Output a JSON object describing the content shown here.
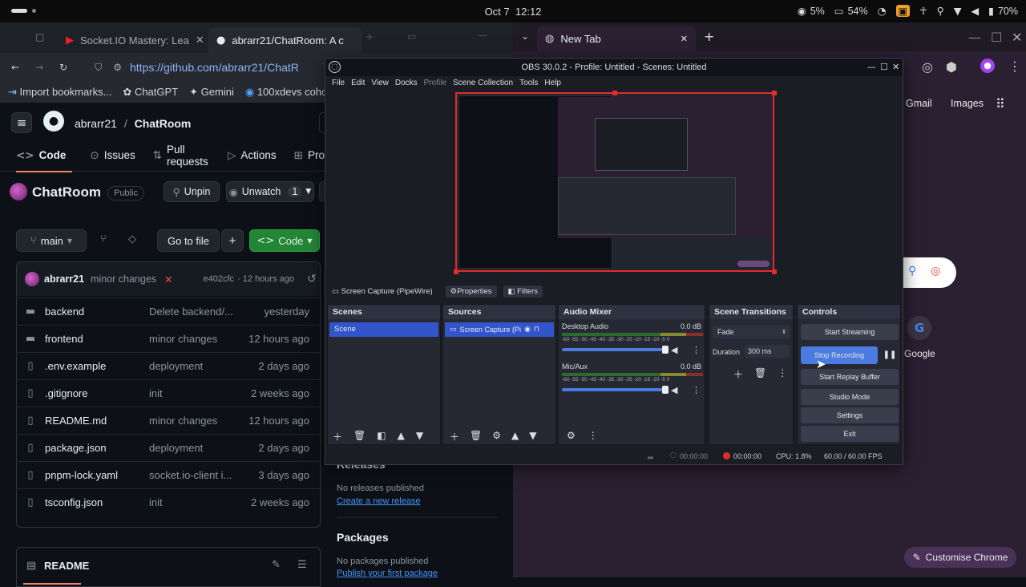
{
  "system": {
    "date": "Oct 7",
    "time": "12:12",
    "cpu": "5%",
    "memory": "54%",
    "battery": "70%"
  },
  "left_browser": {
    "tabs": [
      {
        "title": "Socket.IO Mastery: Lea"
      },
      {
        "title": "abrarr21/ChatRoom: A c"
      }
    ],
    "url": "https://github.com/abrarr21/ChatR",
    "bookmarks": [
      "Import bookmarks...",
      "ChatGPT",
      "Gemini",
      "100xdevs coho"
    ]
  },
  "github": {
    "owner": "abrarr21",
    "separator": "/",
    "repo": "ChatRoom",
    "nav": [
      "Code",
      "Issues",
      "Pull requests",
      "Actions",
      "Pro"
    ],
    "repo_title": "ChatRoom",
    "visibility": "Public",
    "unpin": "Unpin",
    "unwatch": "Unwatch",
    "watch_count": "1",
    "branch": "main",
    "go_to_file": "Go to file",
    "add": "+",
    "code_btn": "Code",
    "commit": {
      "author": "abrarr21",
      "message": "minor changes",
      "status": "✕",
      "hash": "e402cfc",
      "time": "· 12 hours ago"
    },
    "files": [
      {
        "name": "backend",
        "type": "folder",
        "msg": "Delete backend/...",
        "time": "yesterday"
      },
      {
        "name": "frontend",
        "type": "folder",
        "msg": "minor changes",
        "time": "12 hours ago"
      },
      {
        "name": ".env.example",
        "type": "file",
        "msg": "deployment",
        "time": "2 days ago"
      },
      {
        "name": ".gitignore",
        "type": "file",
        "msg": "init",
        "time": "2 weeks ago"
      },
      {
        "name": "README.md",
        "type": "file",
        "msg": "minor changes",
        "time": "12 hours ago"
      },
      {
        "name": "package.json",
        "type": "file",
        "msg": "deployment",
        "time": "2 days ago"
      },
      {
        "name": "pnpm-lock.yaml",
        "type": "file",
        "msg": "socket.io-client i...",
        "time": "3 days ago"
      },
      {
        "name": "tsconfig.json",
        "type": "file",
        "msg": "init",
        "time": "2 weeks ago"
      }
    ],
    "readme": "README",
    "releases_title": "Releases",
    "no_releases": "No releases published",
    "create_release": "Create a new release",
    "packages_title": "Packages",
    "no_packages": "No packages published",
    "publish_package": "Publish your first package"
  },
  "right_browser": {
    "tab_title": "New Tab",
    "gmail": "Gmail",
    "images": "Images",
    "shortcut": "Google",
    "customise": "Customise Chrome"
  },
  "obs": {
    "title": "OBS 30.0.2 - Profile: Untitled - Scenes: Untitled",
    "menu": [
      "File",
      "Edit",
      "View",
      "Docks",
      "Profile",
      "Scene Collection",
      "Tools",
      "Help"
    ],
    "source_bar": {
      "source": "Screen Capture (PipeWire)",
      "properties": "Properties",
      "filters": "Filters"
    },
    "scenes": {
      "title": "Scenes",
      "items": [
        "Scene"
      ]
    },
    "sources": {
      "title": "Sources",
      "items": [
        "Screen Capture (Pi"
      ]
    },
    "mixer": {
      "title": "Audio Mixer",
      "channels": [
        {
          "name": "Desktop Audio",
          "db": "0.0 dB",
          "volume": 1.0
        },
        {
          "name": "Mic/Aux",
          "db": "0.0 dB",
          "volume": 1.0
        }
      ],
      "scale": "-60 -55 -50 -45 -40 -35 -30 -25 -20 -15 -10 -5 0"
    },
    "transitions": {
      "title": "Scene Transitions",
      "type": "Fade",
      "duration_label": "Duration",
      "duration": "300 ms"
    },
    "controls": {
      "title": "Controls",
      "start_streaming": "Start Streaming",
      "stop_recording": "Stop Recording",
      "start_replay": "Start Replay Buffer",
      "studio_mode": "Studio Mode",
      "settings": "Settings",
      "exit": "Exit"
    },
    "status": {
      "stream_time": "00:00:00",
      "rec_time": "00:00:00",
      "cpu": "CPU: 1.8%",
      "fps": "60.00 / 60.00 FPS"
    }
  }
}
